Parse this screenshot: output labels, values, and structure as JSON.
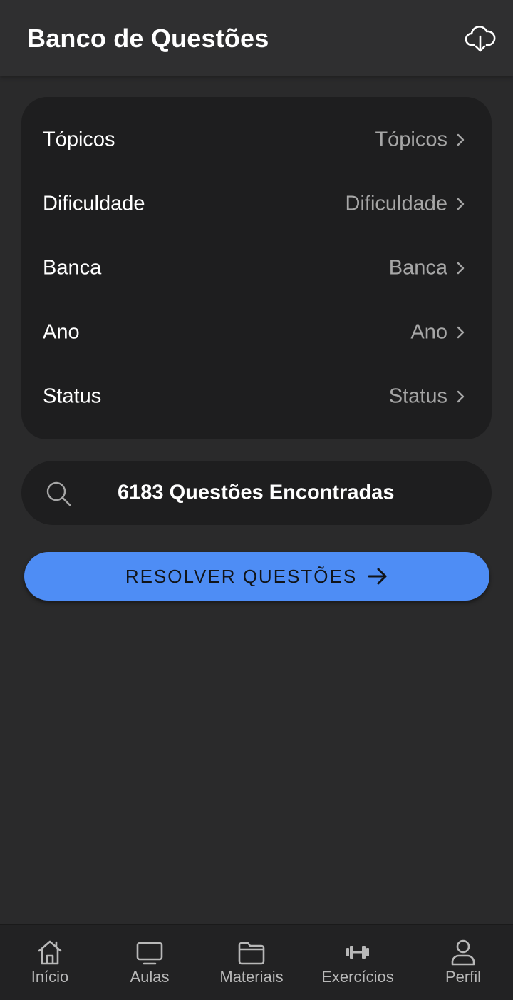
{
  "header": {
    "title": "Banco de Questões",
    "action_icon": "cloud-download-icon"
  },
  "filters": [
    {
      "label": "Tópicos",
      "value": "Tópicos"
    },
    {
      "label": "Dificuldade",
      "value": "Dificuldade"
    },
    {
      "label": "Banca",
      "value": "Banca"
    },
    {
      "label": "Ano",
      "value": "Ano"
    },
    {
      "label": "Status",
      "value": "Status"
    }
  ],
  "search": {
    "icon": "search-icon",
    "count_text": "6183 Questões Encontradas"
  },
  "solve_button": {
    "label": "RESOLVER QUESTÕES",
    "icon": "arrow-right-icon"
  },
  "bottom_nav": {
    "items": [
      {
        "label": "Início",
        "icon": "home-icon"
      },
      {
        "label": "Aulas",
        "icon": "tv-icon"
      },
      {
        "label": "Materiais",
        "icon": "folder-icon"
      },
      {
        "label": "Exercícios",
        "icon": "dumbbell-icon"
      },
      {
        "label": "Perfil",
        "icon": "person-icon"
      }
    ]
  },
  "colors": {
    "background": "#2a2a2b",
    "card": "#1e1e1f",
    "accent": "#4e8df5",
    "muted_text": "#a6a6a6"
  }
}
